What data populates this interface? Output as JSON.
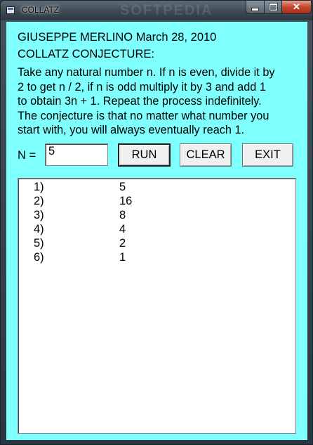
{
  "window": {
    "title": "COLLATZ",
    "watermark": "SOFTPEDIA"
  },
  "header": {
    "author_line": "GIUSEPPE MERLINO  March 28, 2010",
    "heading": "COLLATZ CONJECTURE:"
  },
  "description": {
    "lines": [
      "Take any natural number n. If n is even, divide it by",
      "2 to get n / 2, if n is odd multiply it by 3 and add 1",
      "to obtain 3n + 1. Repeat the process indefinitely.",
      "The conjecture is that no matter what number you",
      "start with, you will always eventually reach 1."
    ]
  },
  "input": {
    "label": "N =",
    "value": "5"
  },
  "buttons": {
    "run": "RUN",
    "clear": "CLEAR",
    "exit": "EXIT"
  },
  "results": [
    {
      "index": "1)",
      "value": "5"
    },
    {
      "index": "2)",
      "value": "16"
    },
    {
      "index": "3)",
      "value": "8"
    },
    {
      "index": "4)",
      "value": "4"
    },
    {
      "index": "5)",
      "value": "2"
    },
    {
      "index": "6)",
      "value": "1"
    }
  ]
}
